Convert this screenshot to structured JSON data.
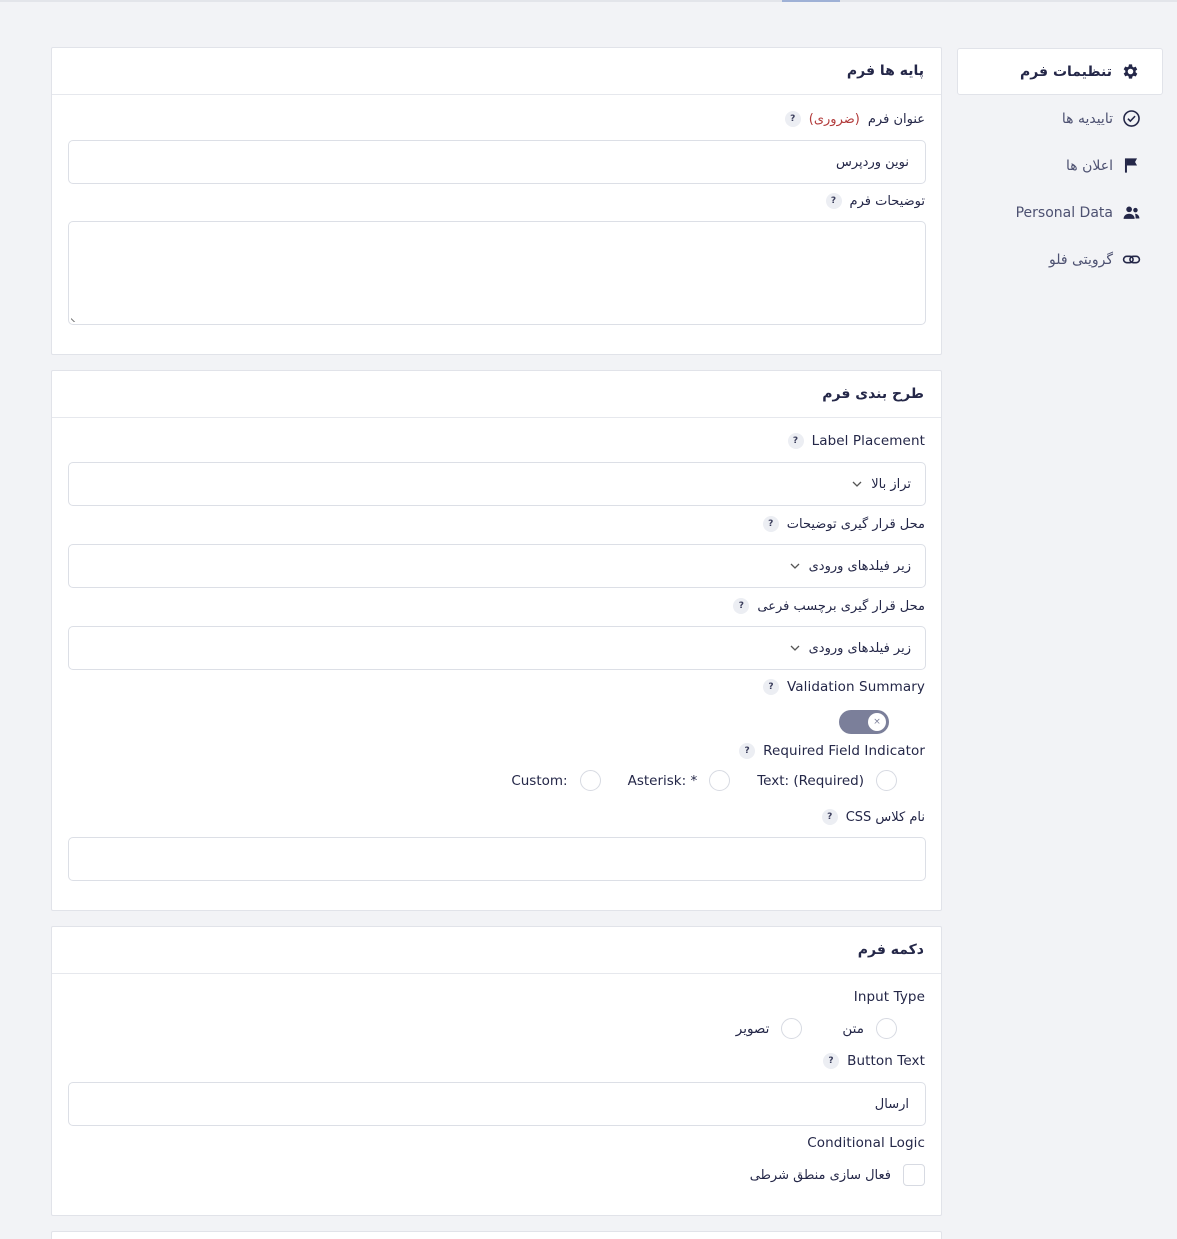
{
  "sidebar": {
    "items": [
      {
        "label": "تنظیمات فرم",
        "icon": "gear-icon"
      },
      {
        "label": "تاییدیه ها",
        "icon": "check-circle-icon"
      },
      {
        "label": "اعلان ها",
        "icon": "flag-icon"
      },
      {
        "label": "Personal Data",
        "icon": "users-icon"
      },
      {
        "label": "گرویتی فلو",
        "icon": "link-icon"
      }
    ]
  },
  "basics": {
    "title": "پایه ها فرم",
    "form_title_label": "عنوان فرم",
    "required_text": "(ضروری)",
    "form_title_value": "نوین وردپرس",
    "description_label": "توضیحات فرم",
    "description_value": ""
  },
  "layout": {
    "title": "طرح بندی فرم",
    "label_placement_label": "Label Placement",
    "label_placement_value": "تراز بالا",
    "description_placement_label": "محل قرار گیری توضیحات",
    "description_placement_value": "زیر فیلدهای ورودی",
    "sublabel_placement_label": "محل قرار گیری برچسب فرعی",
    "sublabel_placement_value": "زیر فیلدهای ورودی",
    "validation_summary_label": "Validation Summary",
    "validation_summary_on": false,
    "required_indicator_label": "Required Field Indicator",
    "required_indicator_options": [
      "Text: (Required)",
      "* :Asterisk",
      ":Custom"
    ],
    "css_class_label": "نام کلاس CSS",
    "css_class_value": ""
  },
  "button": {
    "title": "دکمه فرم",
    "input_type_label": "Input Type",
    "input_type_options": [
      "متن",
      "تصویر"
    ],
    "button_text_label": "Button Text",
    "button_text_value": "ارسال",
    "conditional_logic_label": "Conditional Logic",
    "conditional_logic_checkbox": "فعال سازی منطق شرطی"
  },
  "help_glyph": "?",
  "toggle_glyph": "×",
  "colors": {
    "accent": "#242748",
    "required": "#b23b3b",
    "toggle": "#7b7f9a"
  }
}
